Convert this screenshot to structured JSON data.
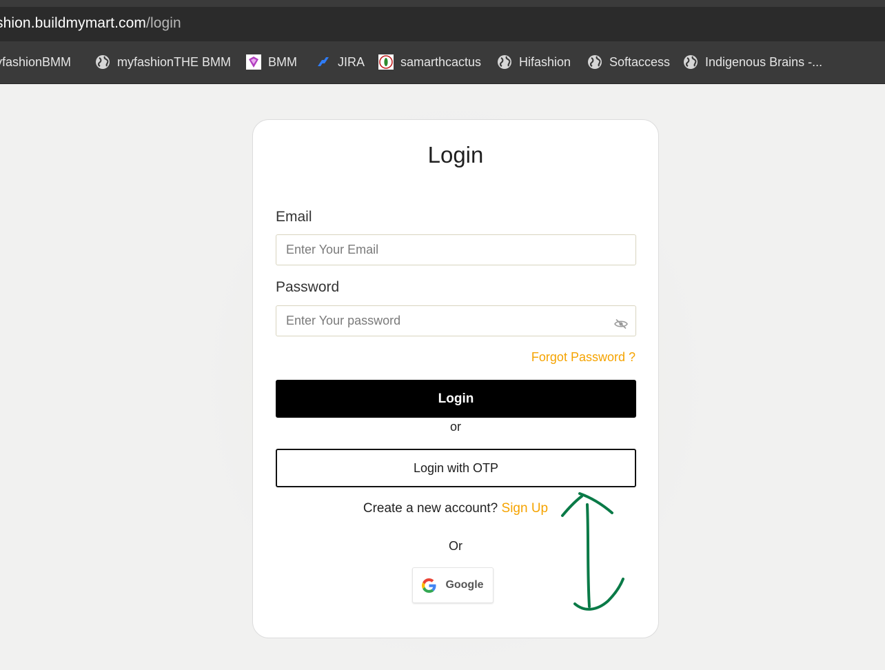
{
  "browser": {
    "url_host": "shion.buildmymart.com",
    "url_path": "/login"
  },
  "bookmarks": [
    {
      "label": "lyfashionBMM",
      "icon": "none"
    },
    {
      "label": "myfashionTHE BMM",
      "icon": "globe-icon"
    },
    {
      "label": "BMM",
      "icon": "bmm-logo-icon"
    },
    {
      "label": "JIRA",
      "icon": "jira-icon"
    },
    {
      "label": "samarthcactus",
      "icon": "cactus-logo-icon"
    },
    {
      "label": "Hifashion",
      "icon": "globe-icon"
    },
    {
      "label": "Softaccess",
      "icon": "globe-icon"
    },
    {
      "label": "Indigenous Brains -...",
      "icon": "globe-icon"
    }
  ],
  "login": {
    "title": "Login",
    "email_label": "Email",
    "email_placeholder": "Enter Your Email",
    "password_label": "Password",
    "password_placeholder": "Enter Your password",
    "forgot_password": "Forgot Password ?",
    "login_button": "Login",
    "or_1": "or",
    "otp_button": "Login with OTP",
    "signup_prompt": "Create a new account?",
    "signup_link": "Sign Up",
    "or_2": "Or",
    "google_button": "Google"
  },
  "colors": {
    "accent": "#f5a300",
    "annotation": "#0a7a47"
  }
}
